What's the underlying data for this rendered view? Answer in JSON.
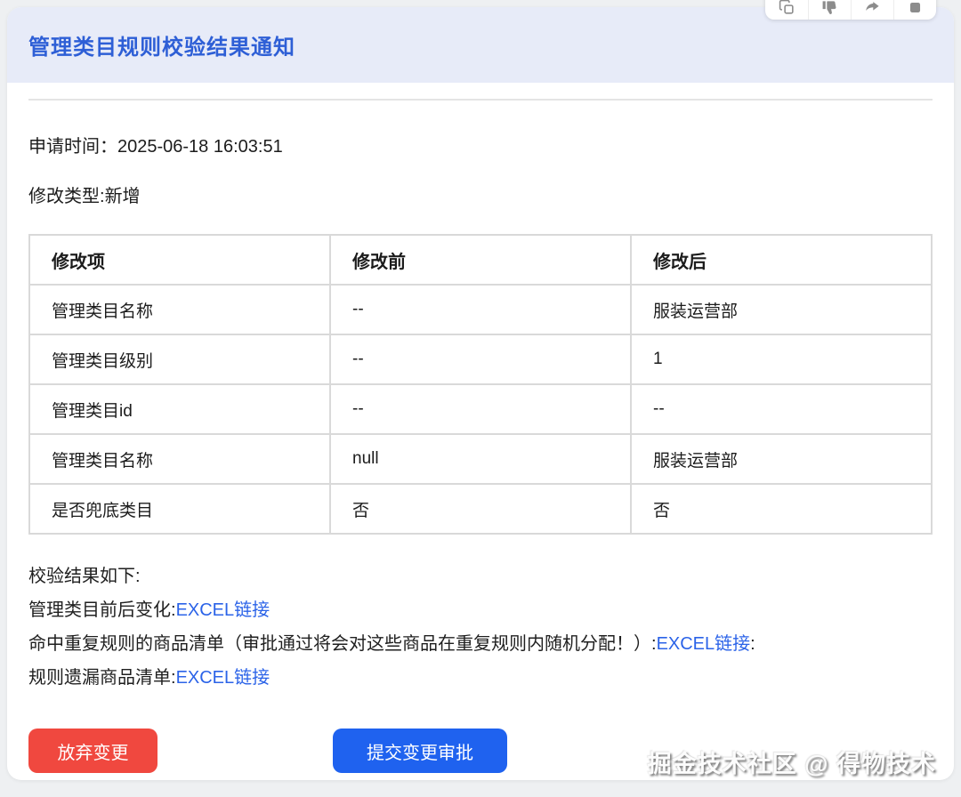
{
  "header": {
    "title": "管理类目规则校验结果通知"
  },
  "toolbar": {
    "icons": [
      "copy-icon",
      "thumbs-down-icon",
      "share-icon",
      "square-icon"
    ]
  },
  "meta": {
    "apply_time_label": "申请时间：",
    "apply_time_value": "2025-06-18 16:03:51",
    "modify_type_label": "修改类型:",
    "modify_type_value": "新增"
  },
  "table": {
    "columns": [
      "修改项",
      "修改前",
      "修改后"
    ],
    "rows": [
      {
        "cells": [
          "管理类目名称",
          "--",
          "服装运营部"
        ]
      },
      {
        "cells": [
          "管理类目级别",
          "--",
          "1"
        ]
      },
      {
        "cells": [
          "管理类目id",
          "--",
          "--"
        ]
      },
      {
        "cells": [
          "管理类目名称",
          "null",
          "服装运营部"
        ]
      },
      {
        "cells": [
          "是否兜底类目",
          "否",
          "否"
        ]
      }
    ]
  },
  "results": {
    "heading": "校验结果如下:",
    "line1_label": "管理类目前后变化:",
    "line1_link": "EXCEL链接",
    "line2_label": "命中重复规则的商品清单（审批通过将会对这些商品在重复规则内随机分配！）:",
    "line2_link": "EXCEL链接",
    "line2_suffix": ":",
    "line3_label": "规则遗漏商品清单:",
    "line3_link": "EXCEL链接"
  },
  "actions": {
    "discard_label": "放弃变更",
    "submit_label": "提交变更审批"
  },
  "watermark": "掘金技术社区 @ 得物技术",
  "colors": {
    "header_bg": "#e7ebf8",
    "title_blue": "#2e5fd6",
    "link_blue": "#2b63e8",
    "danger_red": "#f0483f",
    "primary_blue": "#1f62ef"
  }
}
